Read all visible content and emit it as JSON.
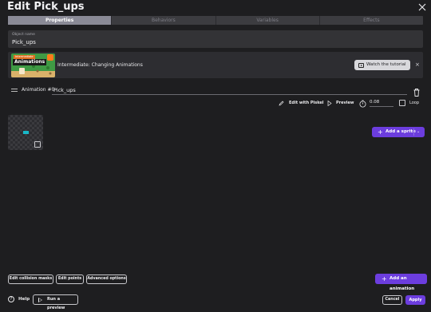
{
  "window": {
    "title": "Edit Pick_ups"
  },
  "tabs": [
    {
      "label": "Properties",
      "active": true
    },
    {
      "label": "Behaviors",
      "active": false
    },
    {
      "label": "Variables",
      "active": false
    },
    {
      "label": "Effects",
      "active": false
    }
  ],
  "object_name": {
    "label": "Object name",
    "value": "Pick_ups"
  },
  "tutorial": {
    "thumbnail_tag": "Intermediate",
    "thumbnail_title": "Animations",
    "text": "Intermediate: Changing Animations",
    "watch_label": "Watch the tutorial",
    "close_label": "×"
  },
  "animation": {
    "label": "Animation #0",
    "name": "Pick_ups"
  },
  "toolbar": {
    "edit_piskel_label": "Edit with Piskel",
    "preview_label": "Preview",
    "fps_value": "0.08",
    "loop_label": "Loop"
  },
  "sprite": {
    "add_label": "Add a sprite",
    "chevron": "⌄"
  },
  "bottom": {
    "edit_collision_label": "Edit collision masks",
    "edit_points_label": "Edit points",
    "advanced_label": "Advanced options",
    "add_animation_label": "Add an animation",
    "help_label": "Help",
    "run_preview_label": "Run a preview",
    "cancel_label": "Cancel",
    "apply_label": "Apply"
  },
  "colors": {
    "accent": "#6c3dde",
    "background": "#1e1e20",
    "panel": "#2d2d31",
    "sprite_fill": "#18b8c8"
  }
}
